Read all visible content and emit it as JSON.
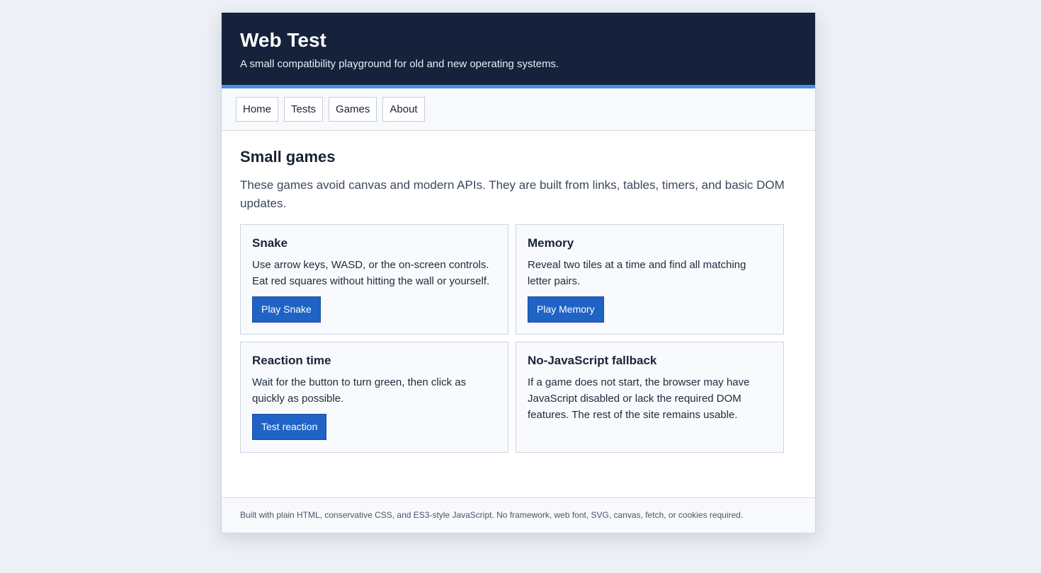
{
  "header": {
    "title": "Web Test",
    "tagline": "A small compatibility playground for old and new operating systems."
  },
  "nav": {
    "items": [
      {
        "label": "Home"
      },
      {
        "label": "Tests"
      },
      {
        "label": "Games"
      },
      {
        "label": "About"
      }
    ]
  },
  "main": {
    "title": "Small games",
    "intro": "These games avoid canvas and modern APIs. They are built from links, tables, timers, and basic DOM updates.",
    "cards": [
      {
        "title": "Snake",
        "text": "Use arrow keys, WASD, or the on-screen controls. Eat red squares without hitting the wall or yourself.",
        "button": "Play Snake"
      },
      {
        "title": "Memory",
        "text": "Reveal two tiles at a time and find all matching letter pairs.",
        "button": "Play Memory"
      },
      {
        "title": "Reaction time",
        "text": "Wait for the button to turn green, then click as quickly as possible.",
        "button": "Test reaction"
      },
      {
        "title": "No-JavaScript fallback",
        "text": "If a game does not start, the browser may have JavaScript disabled or lack the required DOM features. The rest of the site remains usable."
      }
    ]
  },
  "footer": {
    "text": "Built with plain HTML, conservative CSS, and ES3-style JavaScript. No framework, web font, SVG, canvas, fetch, or cookies required."
  },
  "colors": {
    "header_bg": "#16213b",
    "accent": "#4a8df2",
    "button_bg": "#1f63c5"
  }
}
